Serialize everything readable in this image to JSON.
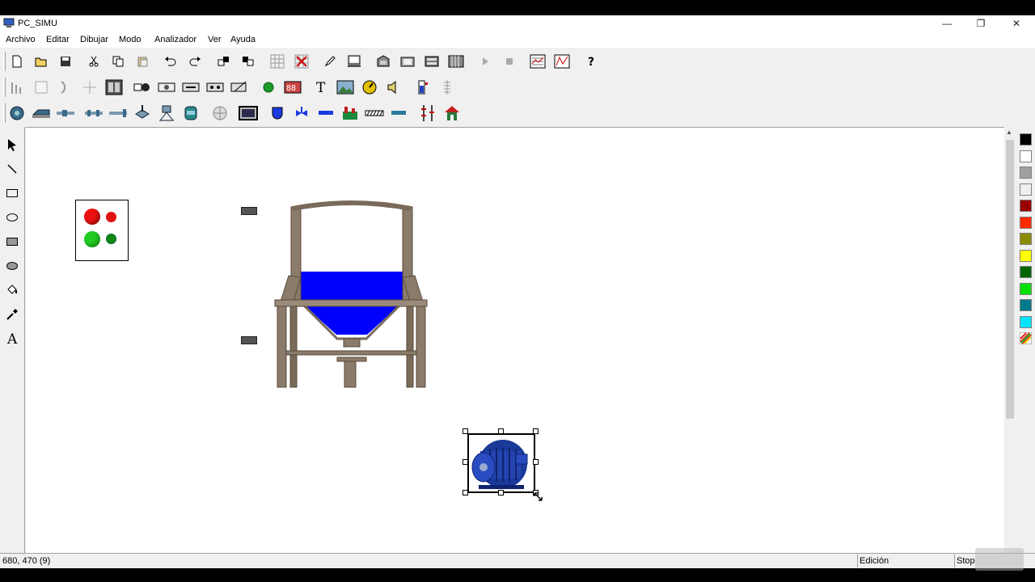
{
  "window": {
    "title": "PC_SIMU",
    "minimize_glyph": "—",
    "restore_glyph": "❐",
    "close_glyph": "✕"
  },
  "menu": [
    "Archivo",
    "Editar",
    "Dibujar",
    "Modo",
    "Analizador",
    "Ver",
    "Ayuda"
  ],
  "toolbar1": [
    "new-icon",
    "open-icon",
    "save-icon",
    "cut-icon",
    "copy-icon",
    "paste-icon",
    "undo-icon",
    "redo-icon",
    "bring-front-icon",
    "send-back-icon",
    "grid-icon",
    "grid-remove-icon",
    "pencil-icon",
    "monitor-icon",
    "device-icon",
    "device2-icon",
    "device3-icon",
    "device4-icon",
    "play-icon",
    "stop-icon",
    "chart-icon",
    "trend-icon",
    "help-icon"
  ],
  "toolbar2": [
    "bar-graph-icon",
    "panel-icon",
    "arc-icon",
    "crosshair-icon",
    "selector-switch-icon",
    "lamp-icon",
    "button-icon",
    "button2-icon",
    "button3-icon",
    "button4-icon",
    "led-icon",
    "display-icon",
    "text-tool-icon",
    "image-tool-icon",
    "gauge-icon",
    "speaker-icon",
    "level-indicator-icon",
    "scale-icon"
  ],
  "toolbar3": [
    "pump-icon",
    "conveyor-icon",
    "pipe-icon",
    "pipe2-icon",
    "pipe3-icon",
    "valve-icon",
    "tank-support-icon",
    "bottle-icon",
    "mixer-icon",
    "screen-icon",
    "cup-icon",
    "valve2-icon",
    "tube-icon",
    "factory-icon",
    "grating-icon",
    "bar-icon",
    "level-scale-icon",
    "house-icon"
  ],
  "left_tools": [
    "pointer-icon",
    "line-icon",
    "rectangle-icon",
    "ellipse-icon",
    "filled-rectangle-icon",
    "filled-ellipse-icon",
    "fill-bucket-icon",
    "eyedropper-icon",
    "text-icon"
  ],
  "text_tool_glyph": "A",
  "text_tool_glyph_small": "T",
  "palette": {
    "colors": [
      "#000000",
      "#ffffff",
      "#a0a0a0",
      "#f0f0f0",
      "#990000",
      "#ff2a00",
      "#8b8b00",
      "#ffff00",
      "#006400",
      "#00e000",
      "#007b8b",
      "#00e5ff"
    ],
    "last_swatch": "multicolor-picker-icon"
  },
  "canvas": {
    "traffic_light": {
      "colors": [
        "#ee1111",
        "#dd1111",
        "#22cc22",
        "#118811"
      ]
    },
    "tank": {
      "liquid_color": "#0000ff",
      "frame_color": "#7a6a5a"
    },
    "motor": {
      "color": "#1a3a9a"
    }
  },
  "status": {
    "coords": "680, 470 (9)",
    "mode": "Edición",
    "state": "Stop"
  }
}
